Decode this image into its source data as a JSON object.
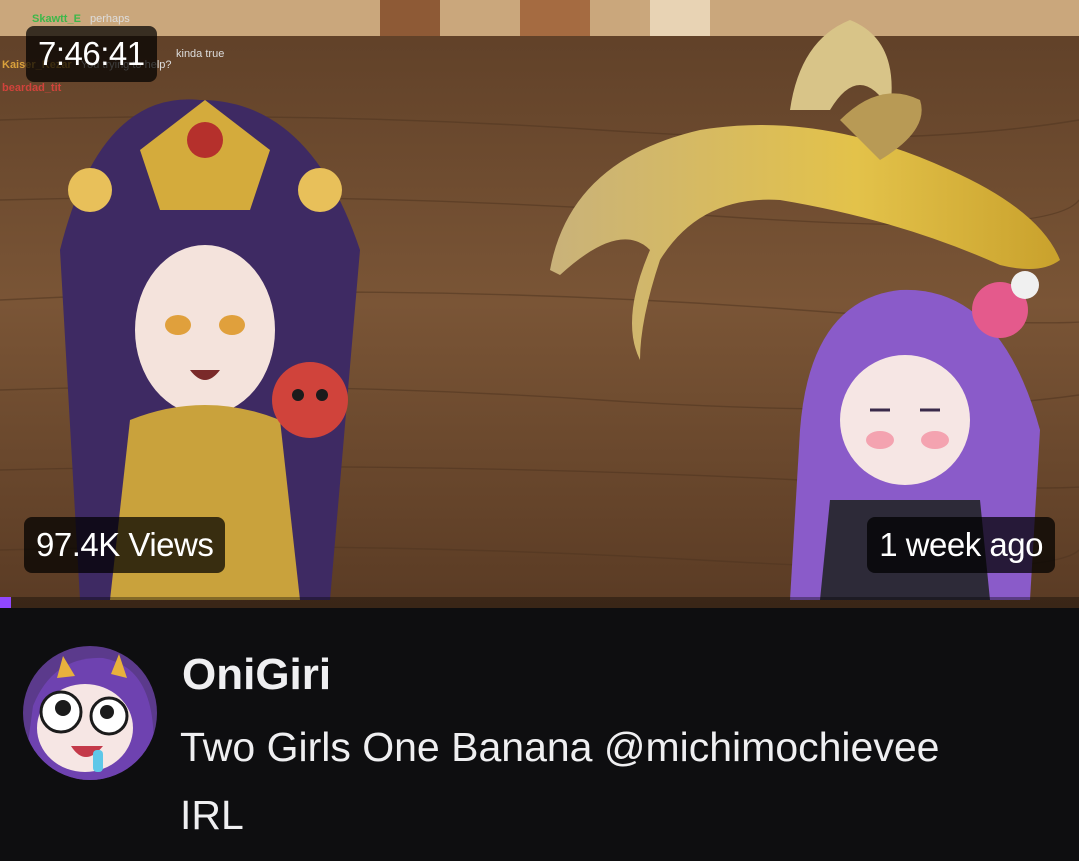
{
  "video": {
    "duration": "7:46:41",
    "views": "97.4K Views",
    "age": "1 week ago",
    "progress_fraction": 0.01
  },
  "chat_overlay": [
    {
      "user": "Skawtt_E",
      "message": "perhaps",
      "color": "#3db84a"
    },
    {
      "user": "Kaiser_Kezar",
      "message": "You trying to help?",
      "color": "#d9a13b"
    },
    {
      "user": "beardad_tit",
      "message": "",
      "color": "#d0433b"
    }
  ],
  "chat_partial": "kinda true",
  "channel": {
    "name": "OniGiri",
    "title": "Two Girls One Banana @michimochievee",
    "category": "IRL"
  },
  "colors": {
    "background": "#0e0e10",
    "text": "#efeff1",
    "accent": "#9147ff"
  }
}
